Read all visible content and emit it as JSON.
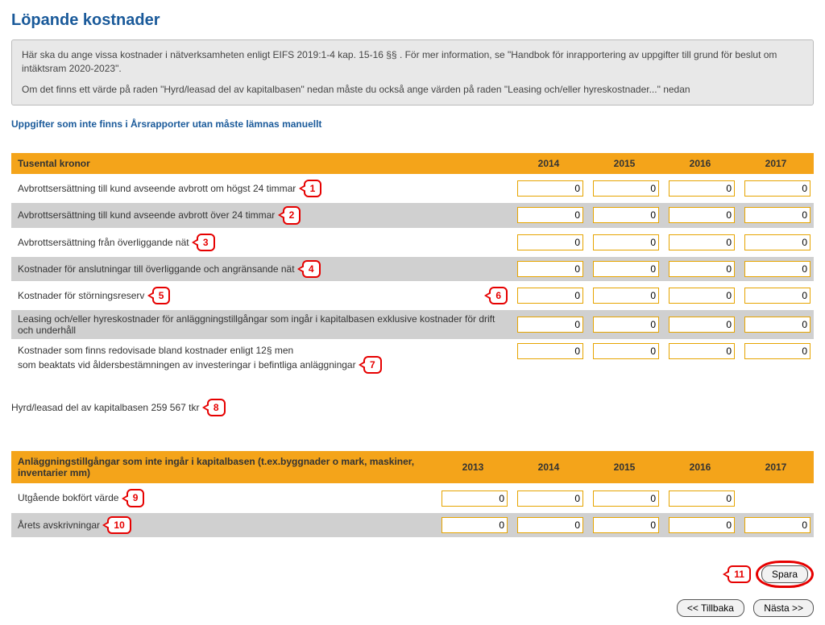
{
  "title": "Löpande kostnader",
  "info": {
    "p1": "Här ska du ange vissa kostnader i nätverksamheten enligt EIFS 2019:1-4 kap. 15-16 §§ . För mer information, se \"Handbok för inrapportering av uppgifter till grund för beslut om intäktsram 2020-2023\".",
    "p2": "Om det finns ett värde på raden \"Hyrd/leasad del av kapitalbasen\" nedan måste du också ange värden på raden \"Leasing och/eller hyreskostnader...\" nedan"
  },
  "sublink": "Uppgifter som inte finns i Årsrapporter utan måste lämnas manuellt",
  "table1": {
    "header_label": "Tusental kronor",
    "years": [
      "2014",
      "2015",
      "2016",
      "2017"
    ],
    "rows": [
      {
        "label": "Avbrottsersättning till kund avseende avbrott om högst 24 timmar",
        "callout": "1",
        "values": [
          "0",
          "0",
          "0",
          "0"
        ],
        "alt": false
      },
      {
        "label": "Avbrottsersättning till kund avseende avbrott över 24 timmar",
        "callout": "2",
        "values": [
          "0",
          "0",
          "0",
          "0"
        ],
        "alt": true
      },
      {
        "label": "Avbrottsersättning från överliggande nät",
        "callout": "3",
        "values": [
          "0",
          "0",
          "0",
          "0"
        ],
        "alt": false
      },
      {
        "label": "Kostnader för anslutningar till överliggande och angränsande nät",
        "callout": "4",
        "values": [
          "0",
          "0",
          "0",
          "0"
        ],
        "alt": true
      },
      {
        "label": "Kostnader för störningsreserv",
        "callout": "5",
        "extra_callout": "6",
        "values": [
          "0",
          "0",
          "0",
          "0"
        ],
        "alt": false
      },
      {
        "label": "Leasing och/eller hyreskostnader för anläggningstillgångar som ingår i kapitalbasen exklusive kostnader för drift och underhåll",
        "callout": "",
        "values": [
          "0",
          "0",
          "0",
          "0"
        ],
        "alt": true
      },
      {
        "label": "Kostnader som finns redovisade bland kostnader enligt 12§ men\nsom beaktats vid åldersbestämningen av investeringar i befintliga anläggningar",
        "callout": "7",
        "values": [
          "0",
          "0",
          "0",
          "0"
        ],
        "alt": false
      }
    ]
  },
  "hydr_label": "Hyrd/leasad del av kapitalbasen 259 567 tkr",
  "hydr_callout": "8",
  "table2": {
    "header_label": "Anläggningstillgångar som inte ingår i kapitalbasen (t.ex.byggnader o mark, maskiner, inventarier mm)",
    "years": [
      "2013",
      "2014",
      "2015",
      "2016",
      "2017"
    ],
    "rows": [
      {
        "label": "Utgående bokfört värde",
        "callout": "9",
        "values": [
          "0",
          "0",
          "0",
          "0",
          ""
        ],
        "alt": false
      },
      {
        "label": "Årets avskrivningar",
        "callout": "10",
        "values": [
          "0",
          "0",
          "0",
          "0",
          "0"
        ],
        "alt": true
      }
    ]
  },
  "buttons": {
    "save_callout": "11",
    "save": "Spara",
    "back": "<< Tillbaka",
    "next": "Nästa >>"
  }
}
